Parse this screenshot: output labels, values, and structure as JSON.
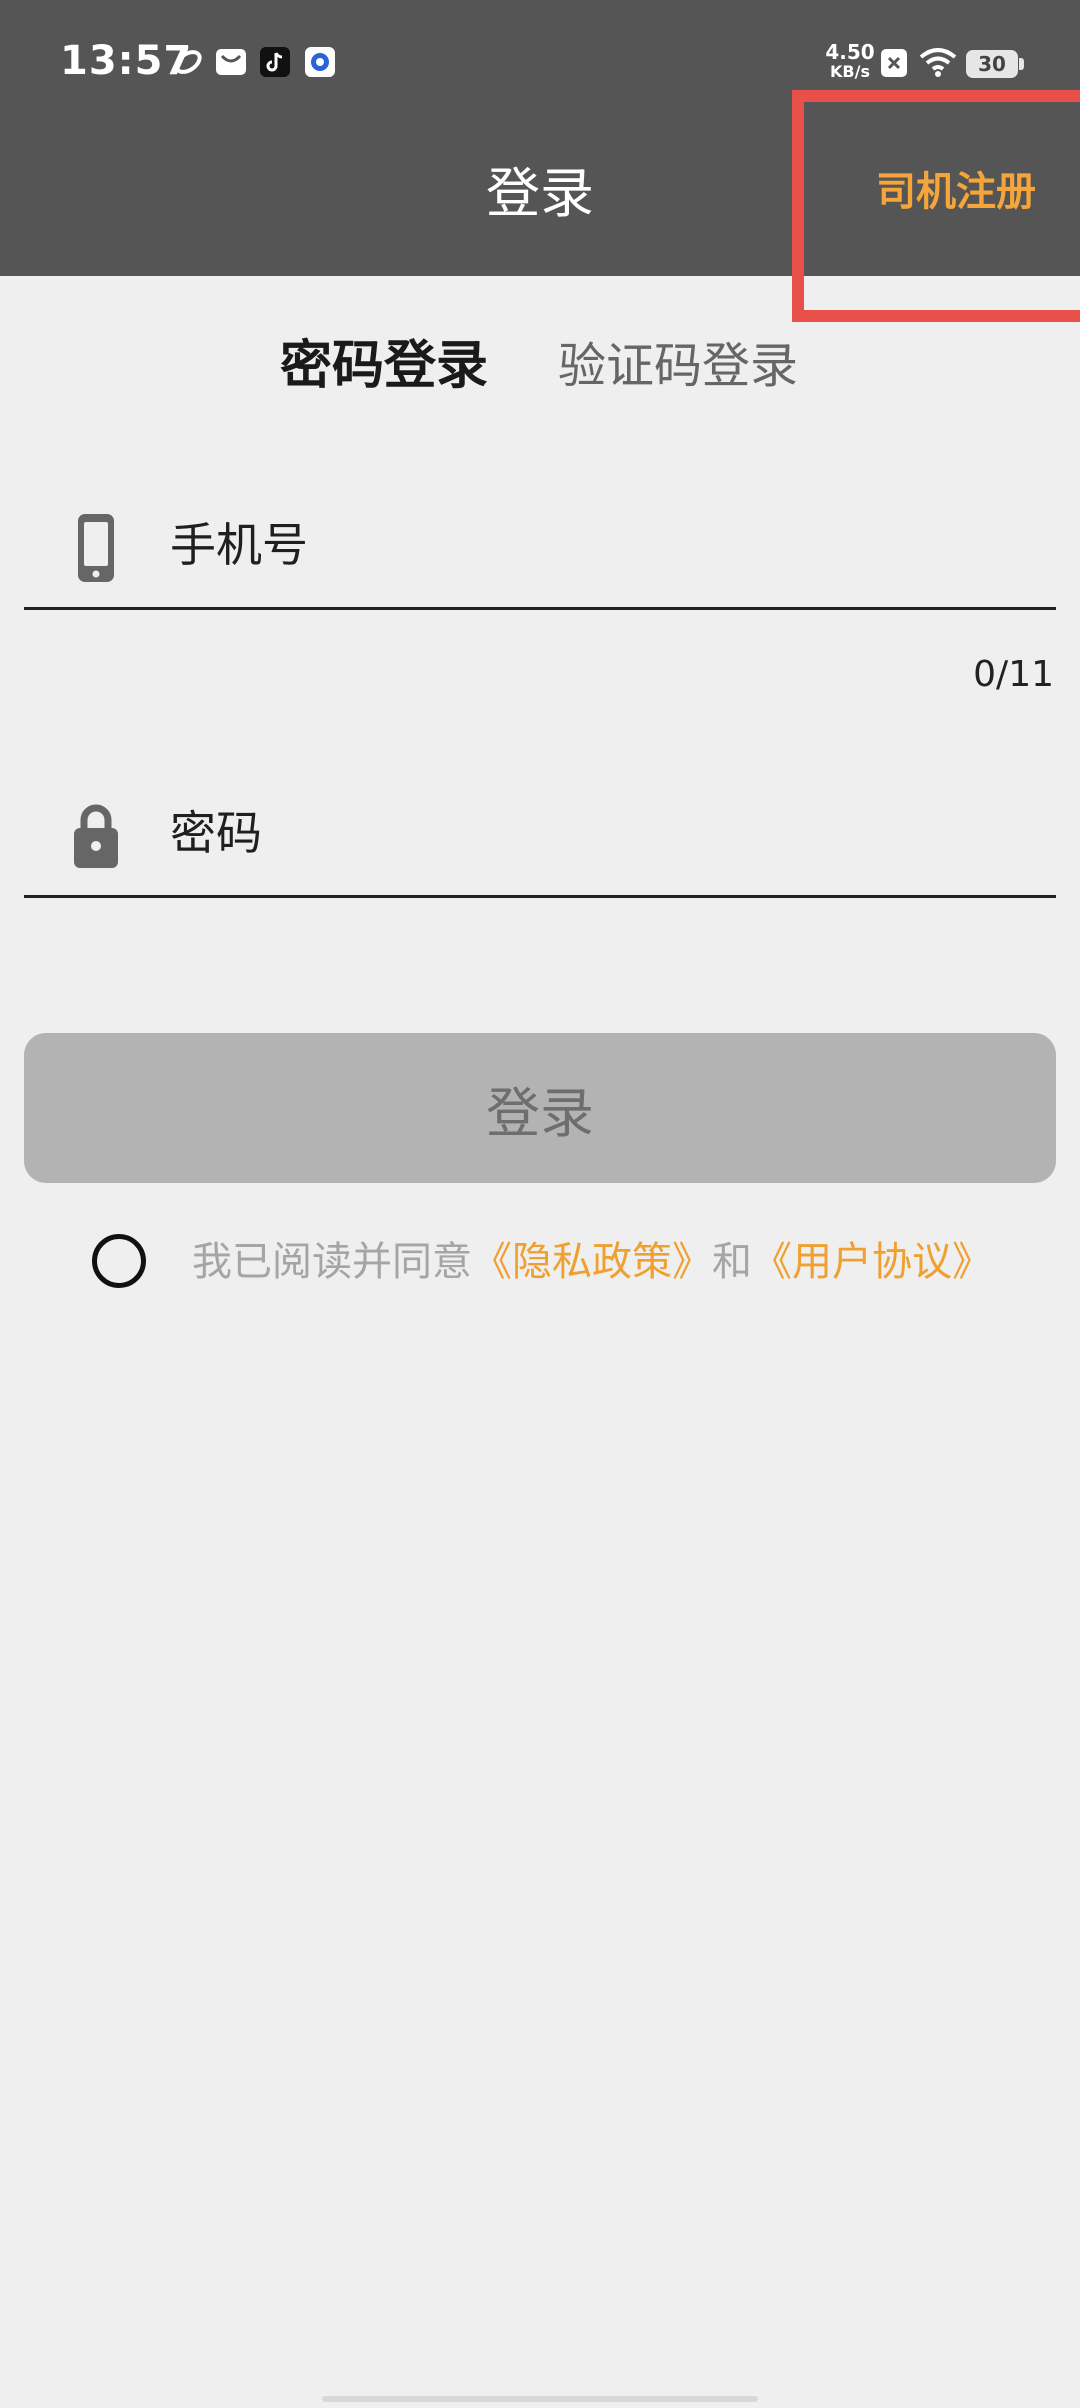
{
  "status_bar": {
    "time": "13:57",
    "net_speed_value": "4.50",
    "net_speed_unit": "KB/s",
    "battery": "30",
    "icons": [
      "sync-icon",
      "mail-icon",
      "tiktok-icon",
      "app-icon",
      "no-sim-icon",
      "wifi-icon",
      "battery-icon"
    ]
  },
  "header": {
    "title": "登录",
    "register_label": "司机注册",
    "register_color": "#f5a53a"
  },
  "tabs": [
    {
      "label": "密码登录",
      "active": true
    },
    {
      "label": "验证码登录",
      "active": false
    }
  ],
  "form": {
    "phone_placeholder": "手机号",
    "phone_value": "",
    "phone_counter": "0/11",
    "password_placeholder": "密码",
    "password_value": ""
  },
  "login_button": {
    "label": "登录"
  },
  "agreement": {
    "prefix": "我已阅读并同意",
    "privacy_link": "《隐私政策》",
    "joiner": "和",
    "user_link": "《用户协议》",
    "checked": false,
    "link_color": "#f0a030"
  },
  "colors": {
    "header_bg": "#555555",
    "page_bg": "#efefef",
    "highlight": "#e8504a",
    "button_disabled": "#b3b3b3"
  }
}
